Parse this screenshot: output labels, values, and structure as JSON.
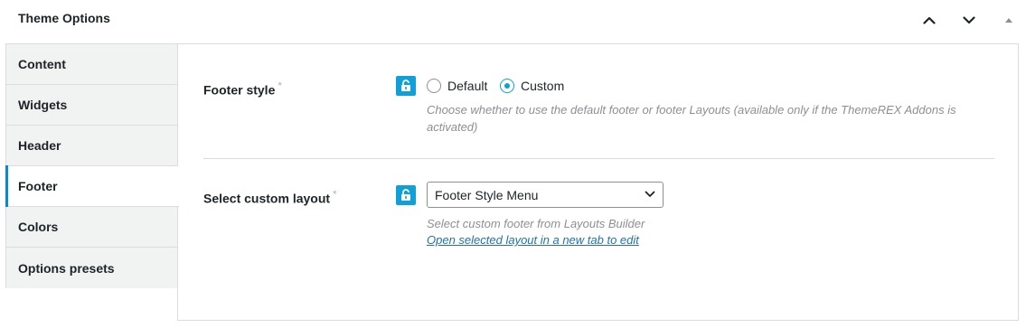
{
  "panel": {
    "title": "Theme Options"
  },
  "tabs": [
    {
      "label": "Content",
      "active": false
    },
    {
      "label": "Widgets",
      "active": false
    },
    {
      "label": "Header",
      "active": false
    },
    {
      "label": "Footer",
      "active": true
    },
    {
      "label": "Colors",
      "active": false
    },
    {
      "label": "Options presets",
      "active": false
    }
  ],
  "footer_style": {
    "label": "Footer style",
    "required_mark": "*",
    "options": [
      {
        "label": "Default",
        "checked": false
      },
      {
        "label": "Custom",
        "checked": true
      }
    ],
    "description": "Choose whether to use the default footer or footer Layouts (available only if the ThemeREX Addons is activated)"
  },
  "custom_layout": {
    "label": "Select custom layout",
    "required_mark": "*",
    "selected": "Footer Style Menu",
    "description": "Select custom footer from Layouts Builder",
    "link_text": "Open selected layout in a new tab to edit"
  },
  "colors": {
    "accent": "#0fa0d9",
    "active_tab_bar": "#0a8bc6",
    "link": "#2271b1"
  },
  "icons": {
    "move_up": "chevron-up-icon",
    "move_down": "chevron-down-icon",
    "toggle": "triangle-up-icon",
    "lock": "unlock-icon",
    "select_arrow": "chevron-down-icon"
  }
}
